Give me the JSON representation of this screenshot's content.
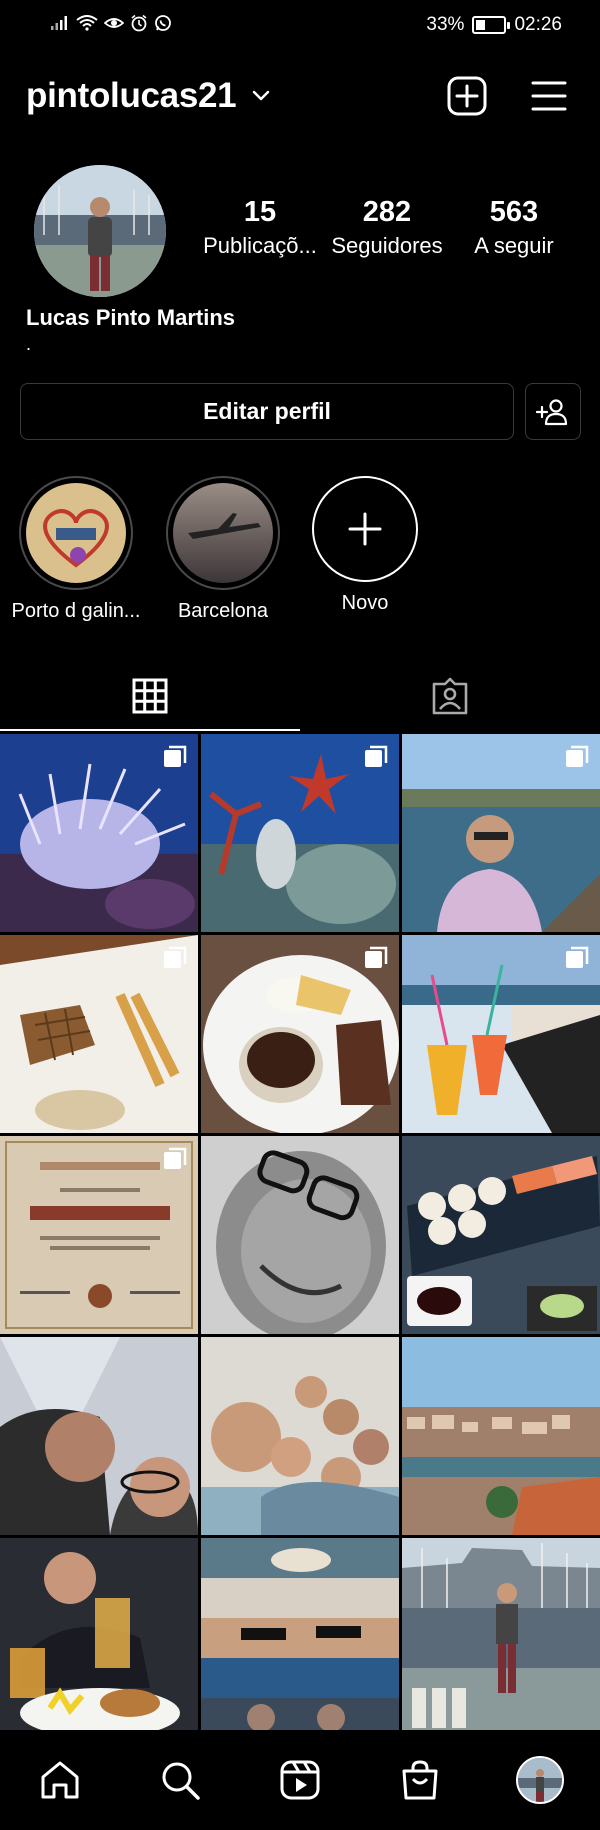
{
  "status_bar": {
    "battery_percent": "33%",
    "time": "02:26",
    "battery_level": 0.33,
    "icons": [
      "signal-icon",
      "wifi-icon",
      "eye-icon",
      "alarm-icon",
      "whatsapp-icon"
    ]
  },
  "header": {
    "username": "pintolucas21",
    "icons": [
      "chevron-down-icon",
      "add-post-icon",
      "menu-icon"
    ]
  },
  "profile": {
    "stats": [
      {
        "value": "15",
        "label": "Publicaçõ..."
      },
      {
        "value": "282",
        "label": "Seguidores"
      },
      {
        "value": "563",
        "label": "A seguir"
      }
    ],
    "full_name": "Lucas Pinto Martins",
    "bio": "."
  },
  "actions": {
    "edit_profile": "Editar perfil",
    "add_person_icon": "add-person-icon"
  },
  "highlights": [
    {
      "label": "Porto d galin..."
    },
    {
      "label": "Barcelona"
    },
    {
      "label": "Novo"
    }
  ],
  "tabs": [
    {
      "name": "grid-icon",
      "active": true
    },
    {
      "name": "tagged-icon",
      "active": false
    }
  ],
  "posts_count_shown": 15,
  "bottom_nav": [
    "home-icon",
    "search-icon",
    "reels-icon",
    "shop-icon",
    "profile-avatar"
  ],
  "colors": {
    "background": "#000000",
    "text": "#ffffff",
    "border": "#3a3a3a"
  }
}
